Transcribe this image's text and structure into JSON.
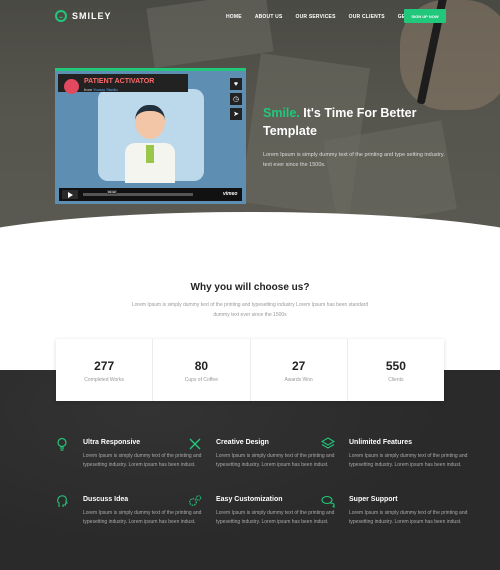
{
  "brand": {
    "name": "SMILEY"
  },
  "nav": {
    "items": [
      "HOME",
      "ABOUT US",
      "OUR SERVICES",
      "OUR CLIENTS",
      "GET IT NOW"
    ],
    "signup": "SIGN UP NOW"
  },
  "video": {
    "title": "PATIENT ACTIVATOR",
    "from": "from",
    "author": "Yourzy Studio",
    "time": "01:42",
    "brand": "vimeo"
  },
  "hero": {
    "title_accent": "Smile.",
    "title_rest": " It's Time For Better Template",
    "text": "Lorem Ipsum is simply dummy text of the printing and type setting industry. text ever since the 1500s."
  },
  "why": {
    "title": "Why you will choose us?",
    "text": "Lorem Ipsum is simply dummy text of the printing and typesetting industry Lorem Ipsum has been standard dummy text ever since the 1500s"
  },
  "stats": [
    {
      "value": "277",
      "label": "Completed Works"
    },
    {
      "value": "80",
      "label": "Cups of Coffee"
    },
    {
      "value": "27",
      "label": "Awards Won"
    },
    {
      "value": "550",
      "label": "Clients"
    }
  ],
  "features": [
    {
      "title": "Ultra Responsive",
      "text": "Lorem Ipsum is simply dummy text of the printing and typesetting industry. Lorem ipsum has been indust.",
      "icon": "lightbulb-icon"
    },
    {
      "title": "Creative Design",
      "text": "Lorem Ipsum is simply dummy text of the printing and typesetting industry. Lorem ipsum has been indust.",
      "icon": "pencil-ruler-icon"
    },
    {
      "title": "Unlimited Features",
      "text": "Lorem Ipsum is simply dummy text of the printing and typesetting industry. Lorem ipsum has been indust.",
      "icon": "layers-icon"
    },
    {
      "title": "Duscuss Idea",
      "text": "Lorem Ipsum is simply dummy text of the printing and typesetting industry. Lorem ipsum has been indust.",
      "icon": "head-idea-icon"
    },
    {
      "title": "Easy Customization",
      "text": "Lorem Ipsum is simply dummy text of the printing and typesetting industry. Lorem ipsum has been indust.",
      "icon": "gears-icon"
    },
    {
      "title": "Super Support",
      "text": "Lorem Ipsum is simply dummy text of the printing and typesetting industry. Lorem ipsum has been indust.",
      "icon": "chat-bubbles-icon"
    }
  ],
  "colors": {
    "accent": "#21c77a",
    "dark": "#2a2b2b"
  }
}
